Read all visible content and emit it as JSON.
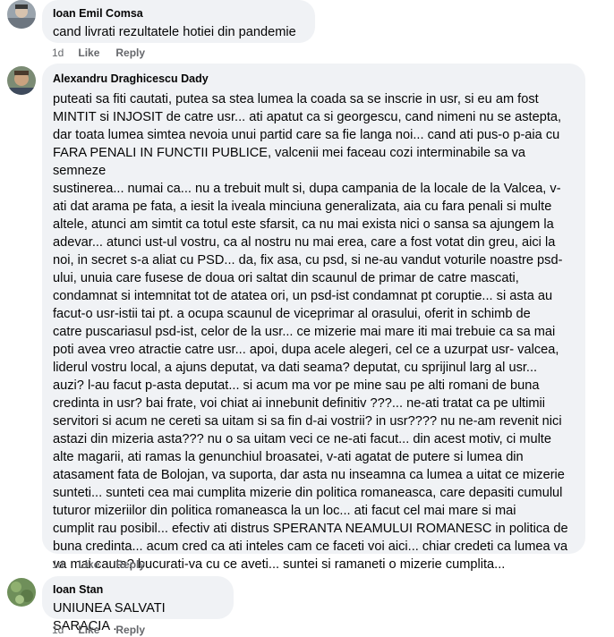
{
  "comments": [
    {
      "author": "Ioan Emil Comsa",
      "text": "cand livrati rezultatele hotiei din pandemie",
      "time": "1d",
      "like_label": "Like",
      "reply_label": "Reply"
    },
    {
      "author": "Alexandru Draghicescu Dady",
      "text": "puteati sa fiti cautati, putea sa stea lumea la coada sa se inscrie in usr, si eu am fost\nMINTIT si INJOSIT de catre usr... ati apatut ca si georgescu, cand nimeni nu se astepta,\ndar toata lumea simtea nevoia unui partid care sa fie langa noi... cand ati pus-o p-aia cu\nFARA PENALI IN FUNCTII PUBLICE, valcenii mei faceau cozi interminabile sa va semneze\nsustinerea... numai ca... nu a trebuit mult si, dupa campania de la locale de la Valcea, v-\nati dat arama pe fata, a iesit la iveala minciuna generalizata, aia cu fara penali si multe\naltele, atunci am simtit ca totul este sfarsit, ca nu mai exista nici o sansa sa ajungem la\nadevar... atunci ust-ul vostru, ca al nostru nu mai erea, care a fost votat din greu, aici la\nnoi, in secret s-a aliat cu PSD... da, fix asa, cu psd, si ne-au vandut voturile noastre psd-\nului, unuia care fusese de doua ori saltat din scaunul de primar de catre mascati,\ncondamnat si intemnitat tot de atatea ori, un psd-ist condamnat pt coruptie... si asta au\nfacut-o usr-istii tai pt. a ocupa scaunul de viceprimar al orasului, oferit in schimb de\ncatre puscariasul psd-ist, celor de la usr... ce mizerie mai mare iti mai trebuie ca sa mai\npoti avea vreo atractie catre usr... apoi, dupa acele alegeri, cel ce a uzurpat usr- valcea,\nliderul vostru local, a ajuns deputat, va dati seama? deputat, cu sprijinul larg al usr...\nauzi? l-au facut p-asta deputat... si acum ma vor pe mine sau pe alti romani de buna\ncredinta in usr? bai frate, voi chiat ai innebunit definitiv ???... ne-ati tratat ca pe ultimii\nservitori si acum ne cereti sa uitam si sa fin d-ai vostrii? in usr???? nu ne-am revenit nici\nastazi din mizeria asta??? nu o sa uitam veci ce ne-ati facut... din acest motiv, ci multe\nalte magarii, ati ramas la genunchiul broasatei, v-ati agatat de putere si lumea din\natasament fata de Bolojan, va suporta, dar asta nu inseamna ca lumea a uitat ce mizerie\nsunteti... sunteti cea mai cumplita mizerie din politica romaneasca, care depasiti cumulul\ntuturor mizeriilor din politica romaneasca la un loc... ati facut cel mai mare si mai\ncumplit rau posibil... efectiv ati distrus SPERANTA NEAMULUI ROMANESC in politica de\nbuna credinta... acum cred ca ati inteles cam ce faceti voi aici... chiar credeti ca lumea va\nva mai cauta? bucurati-va cu ce aveti... suntei si ramaneti o mizerie cumplita...",
      "time": "1d",
      "like_label": "Like",
      "reply_label": "Reply"
    },
    {
      "author": "Ioan Stan",
      "text": "UNIUNEA SALVATI SARACIA .",
      "time": "1d",
      "like_label": "Like",
      "reply_label": "Reply"
    }
  ]
}
